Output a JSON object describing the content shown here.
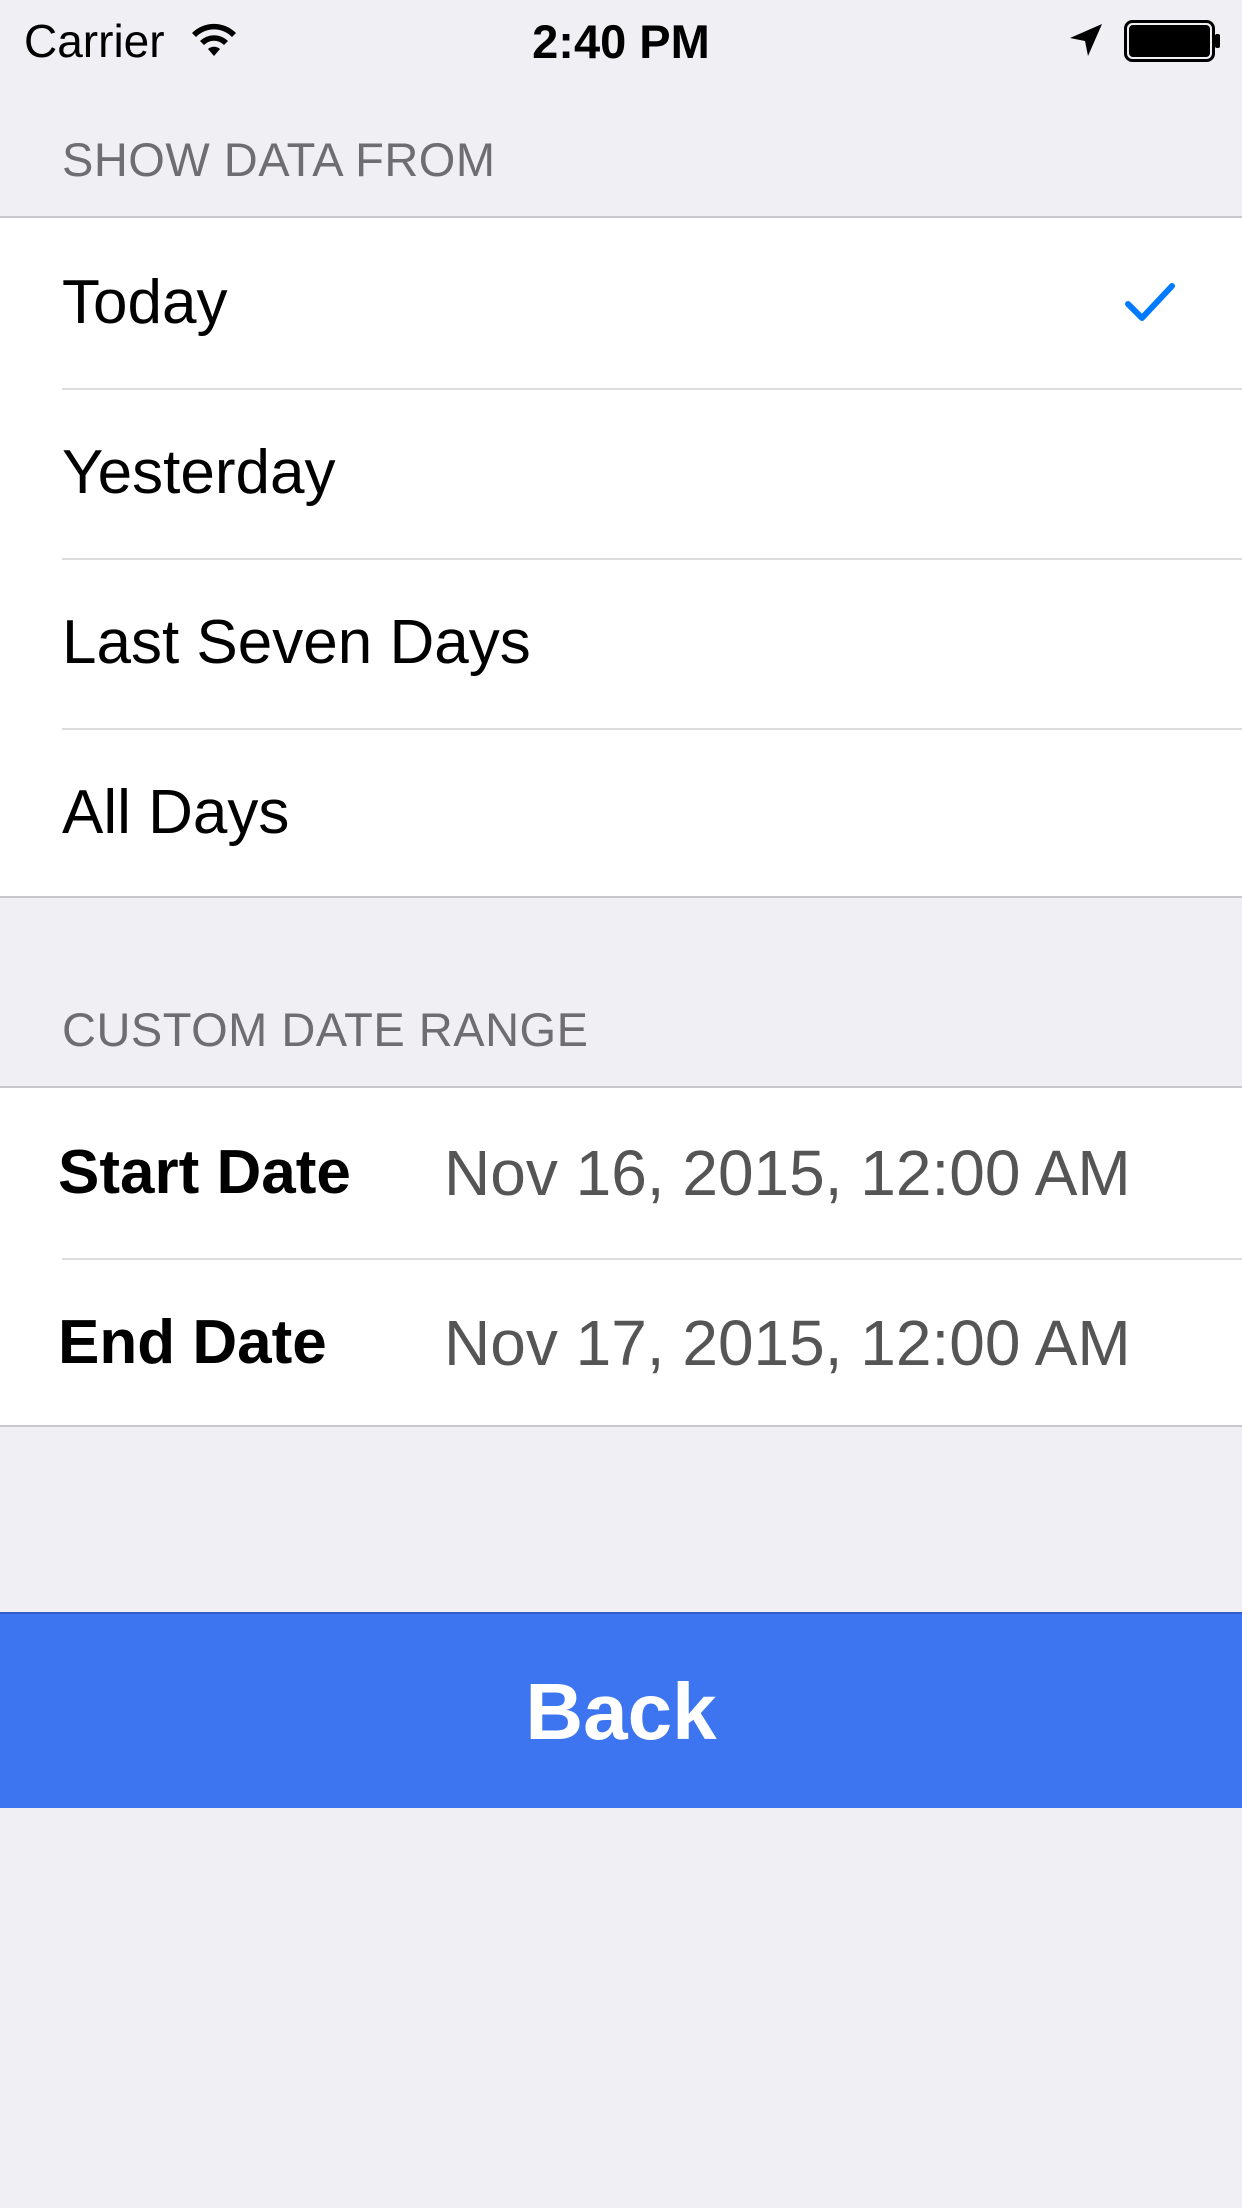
{
  "status_bar": {
    "carrier": "Carrier",
    "time": "2:40 PM",
    "icons": [
      "wifi-icon",
      "location-arrow-icon",
      "battery-icon"
    ]
  },
  "show_data_from": {
    "header": "SHOW DATA FROM",
    "options": [
      {
        "label": "Today",
        "selected": true
      },
      {
        "label": "Yesterday",
        "selected": false
      },
      {
        "label": "Last Seven Days",
        "selected": false
      },
      {
        "label": "All Days",
        "selected": false
      }
    ]
  },
  "custom_date_range": {
    "header": "CUSTOM DATE RANGE",
    "start": {
      "label": "Start Date",
      "value": "Nov 16, 2015, 12:00 AM"
    },
    "end": {
      "label": "End Date",
      "value": "Nov 17, 2015, 12:00 AM"
    }
  },
  "back_button": {
    "label": "Back"
  },
  "colors": {
    "background": "#efeff4",
    "accent": "#007aff",
    "button": "#3d75f0",
    "header_text": "#6d6d72",
    "value_text": "#555555"
  }
}
